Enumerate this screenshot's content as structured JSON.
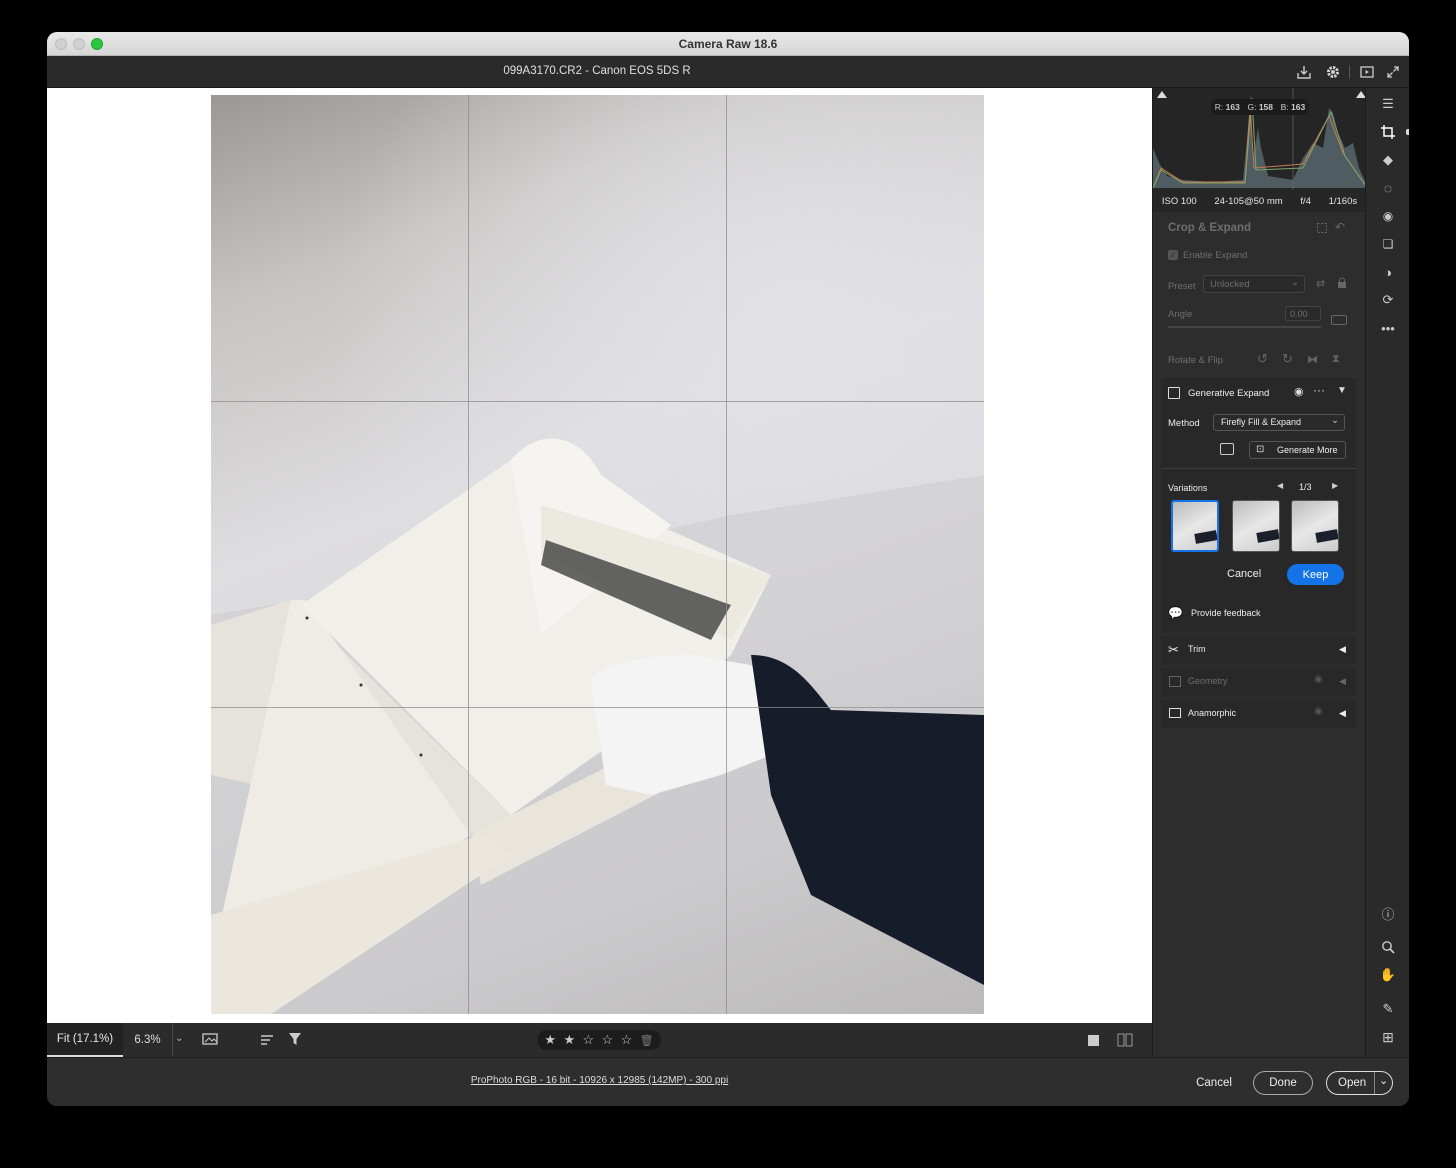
{
  "window": {
    "title": "Camera Raw 18.6"
  },
  "header": {
    "file_title": "099A3170.CR2  -  Canon EOS 5DS R"
  },
  "histogram": {
    "r_label": "R:",
    "r": "163",
    "g_label": "G:",
    "g": "158",
    "b_label": "B:",
    "b": "163"
  },
  "exif": {
    "iso": "ISO 100",
    "lens": "24-105@50 mm",
    "aperture": "f/4",
    "shutter": "1/160s"
  },
  "crop": {
    "title": "Crop & Expand",
    "enable_expand": "Enable Expand",
    "preset_label": "Preset",
    "preset_value": "Unlocked",
    "angle_label": "Angle",
    "angle_value": "0.00",
    "rotate_flip": "Rotate & Flip"
  },
  "gen_expand": {
    "title": "Generative Expand",
    "method_label": "Method",
    "method_value": "Firefly Fill & Expand",
    "generate_more": "Generate More",
    "variations_label": "Variations",
    "variation_counter": "1/3",
    "cancel": "Cancel",
    "keep": "Keep",
    "feedback": "Provide feedback"
  },
  "sections": {
    "trim": "Trim",
    "geometry": "Geometry",
    "anamorphic": "Anamorphic"
  },
  "toolbar": {
    "fit": "Fit (17.1%)",
    "zoom": "6.3%"
  },
  "rating": {
    "stars": [
      "★",
      "★",
      "☆",
      "☆",
      "☆"
    ],
    "value": 2
  },
  "footer": {
    "info": "ProPhoto RGB - 16 bit - 10926 x 12985 (142MP) - 300 ppi",
    "cancel": "Cancel",
    "done": "Done",
    "open": "Open"
  },
  "colors": {
    "accent": "#1473e6",
    "panel": "#2d2d2d",
    "canvas": "#ffffff"
  }
}
